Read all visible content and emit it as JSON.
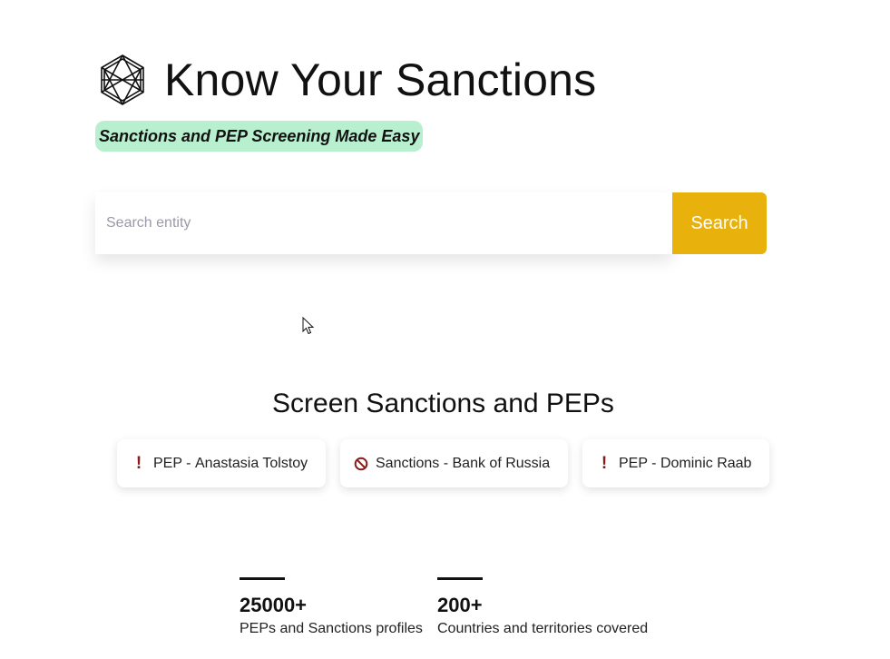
{
  "header": {
    "title": "Know Your Sanctions",
    "tagline": "Sanctions and PEP Screening Made Easy",
    "logo_icon": "hexagon-logo-icon"
  },
  "search": {
    "placeholder": "Search entity",
    "value": "",
    "button_label": "Search"
  },
  "section": {
    "title": "Screen Sanctions and PEPs"
  },
  "examples": [
    {
      "icon": "exclamation-icon",
      "type": "PEP - ",
      "name": "Anastasia Tolstoy"
    },
    {
      "icon": "prohibited-icon",
      "type": "Sanctions - ",
      "name": "Bank of Russia"
    },
    {
      "icon": "exclamation-icon",
      "type": "PEP - ",
      "name": "Dominic Raab"
    }
  ],
  "stats": [
    {
      "value": "25000+",
      "label": "PEPs and Sanctions profiles"
    },
    {
      "value": "200+",
      "label": "Countries and territories covered"
    }
  ],
  "colors": {
    "accent": "#e8b10c",
    "tagline_bg": "#b8f0cf",
    "warning": "#8b1a1a"
  }
}
